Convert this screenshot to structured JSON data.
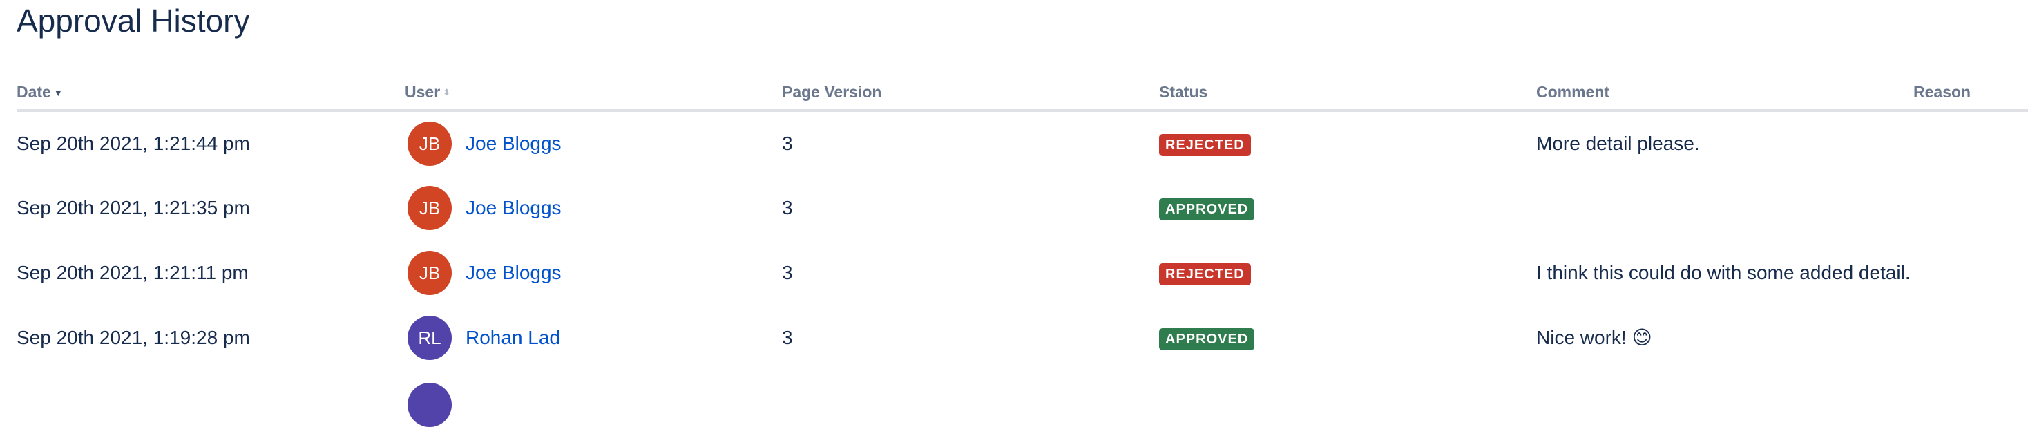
{
  "title": "Approval History",
  "columns": {
    "date": "Date",
    "user": "User",
    "version": "Page Version",
    "status": "Status",
    "comment": "Comment",
    "reason": "Reason"
  },
  "rows": [
    {
      "date": "Sep 20th 2021, 1:21:44 pm",
      "initials": "JB",
      "avatar_color": "#d24524",
      "user": "Joe Bloggs",
      "version": "3",
      "status": "REJECTED",
      "status_color": "#c9372c",
      "comment": "More detail please.",
      "reason": ""
    },
    {
      "date": "Sep 20th 2021, 1:21:35 pm",
      "initials": "JB",
      "avatar_color": "#d24524",
      "user": "Joe Bloggs",
      "version": "3",
      "status": "APPROVED",
      "status_color": "#2f7d4f",
      "comment": "",
      "reason": ""
    },
    {
      "date": "Sep 20th 2021, 1:21:11 pm",
      "initials": "JB",
      "avatar_color": "#d24524",
      "user": "Joe Bloggs",
      "version": "3",
      "status": "REJECTED",
      "status_color": "#c9372c",
      "comment": "I think this could do with some added detail.",
      "reason": ""
    },
    {
      "date": "Sep 20th 2021, 1:19:28 pm",
      "initials": "RL",
      "avatar_color": "#5243aa",
      "user": "Rohan Lad",
      "version": "3",
      "status": "APPROVED",
      "status_color": "#2f7d4f",
      "comment": "Nice work! 😊",
      "reason": ""
    }
  ],
  "partial_row": {
    "avatar_color": "#5243aa"
  }
}
